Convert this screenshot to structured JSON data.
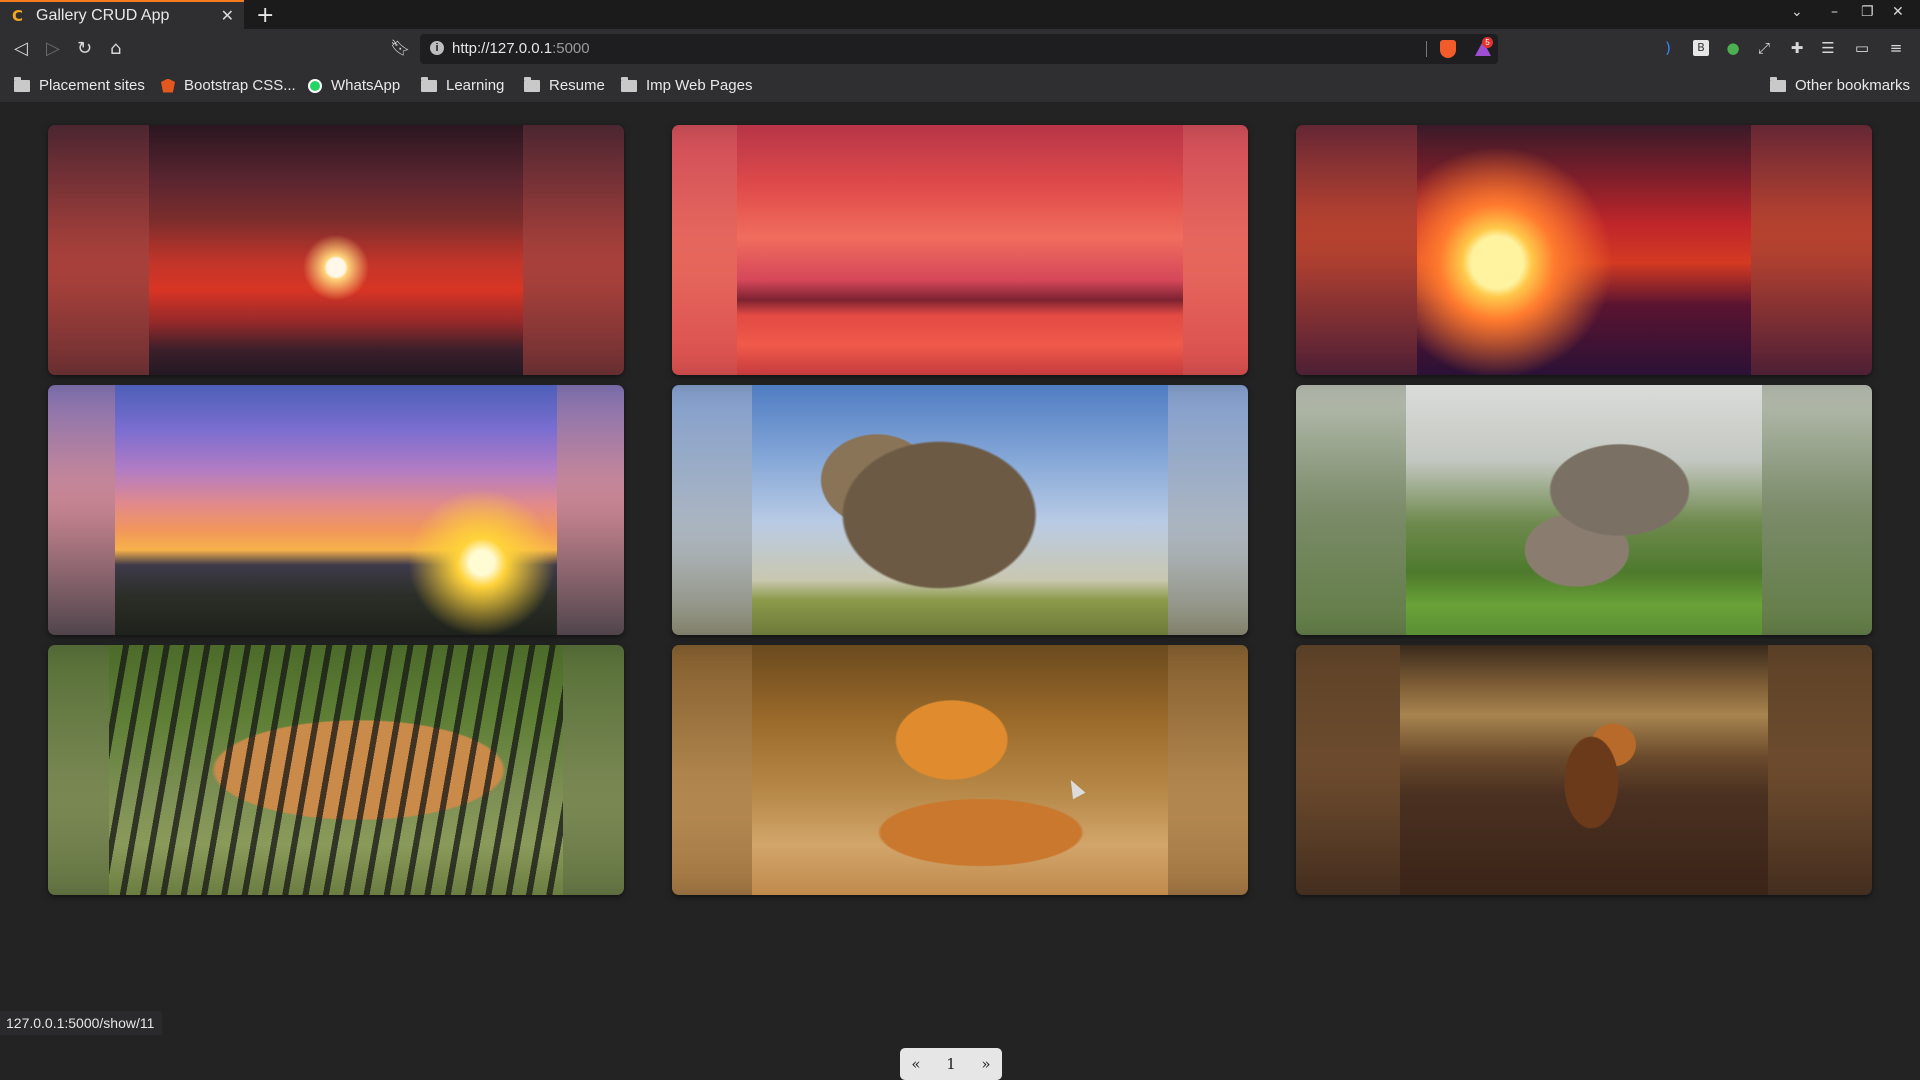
{
  "browser": {
    "tab_title": "Gallery CRUD App",
    "tab_close": "✕",
    "new_tab": "+",
    "url_host": "http://127.0.0.1",
    "url_port": ":5000",
    "rewards_badge": "5",
    "status_url": "127.0.0.1:5000/show/11"
  },
  "bookmarks": [
    {
      "label": "Placement sites",
      "icon": "folder-icon"
    },
    {
      "label": "Bootstrap CSS...",
      "icon": "bootstrap-icon"
    },
    {
      "label": "WhatsApp",
      "icon": "whatsapp-icon"
    },
    {
      "label": "Learning",
      "icon": "folder-icon"
    },
    {
      "label": "Resume",
      "icon": "folder-icon"
    },
    {
      "label": "Imp Web Pages",
      "icon": "folder-icon"
    }
  ],
  "other_bookmarks": "Other bookmarks",
  "gallery": {
    "images": [
      {
        "subject": "sunset-clouds"
      },
      {
        "subject": "red-sky-sea"
      },
      {
        "subject": "sunset-grass"
      },
      {
        "subject": "sunset-hills"
      },
      {
        "subject": "elephant-tusks"
      },
      {
        "subject": "elephant-mother-calf"
      },
      {
        "subject": "tiger-walking"
      },
      {
        "subject": "tiger-roaring"
      },
      {
        "subject": "lion-walking"
      }
    ]
  },
  "pagination": {
    "prev": "«",
    "current": "1",
    "next": "»"
  },
  "colors": {
    "accent": "#f57b1f",
    "page_background": "#232323"
  }
}
